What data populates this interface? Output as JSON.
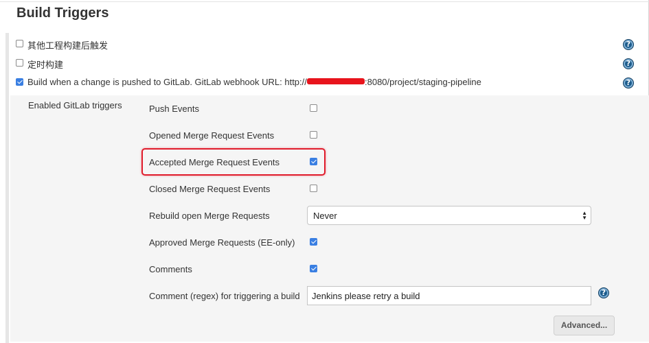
{
  "section": {
    "title": "Build Triggers"
  },
  "triggers": [
    {
      "label": "其他工程构建后触发",
      "checked": false
    },
    {
      "label": "定时构建",
      "checked": false
    },
    {
      "label": "Build when a change is pushed to GitLab. GitLab webhook URL: http://",
      "label_suffix": ":8080/project/staging-pipeline",
      "checked": true
    }
  ],
  "gitlab": {
    "section_label": "Enabled GitLab triggers",
    "events": [
      {
        "label": "Push Events",
        "checked": false
      },
      {
        "label": "Opened Merge Request Events",
        "checked": false
      },
      {
        "label": "Accepted Merge Request Events",
        "checked": true
      },
      {
        "label": "Closed Merge Request Events",
        "checked": false
      }
    ],
    "rebuild": {
      "label": "Rebuild open Merge Requests",
      "value": "Never"
    },
    "approved": {
      "label": "Approved Merge Requests (EE-only)",
      "checked": true
    },
    "comments": {
      "label": "Comments",
      "checked": true
    },
    "comment_regex": {
      "label": "Comment (regex) for triggering a build",
      "value": "Jenkins please retry a build"
    },
    "advanced_button": "Advanced..."
  },
  "icons": {
    "help": "help-icon",
    "help_glyph": "?"
  },
  "colors": {
    "accent": "#3a7fe2",
    "highlight": "#e01b2b",
    "help": "#1d5c8c",
    "redaction": "#e8141c"
  }
}
